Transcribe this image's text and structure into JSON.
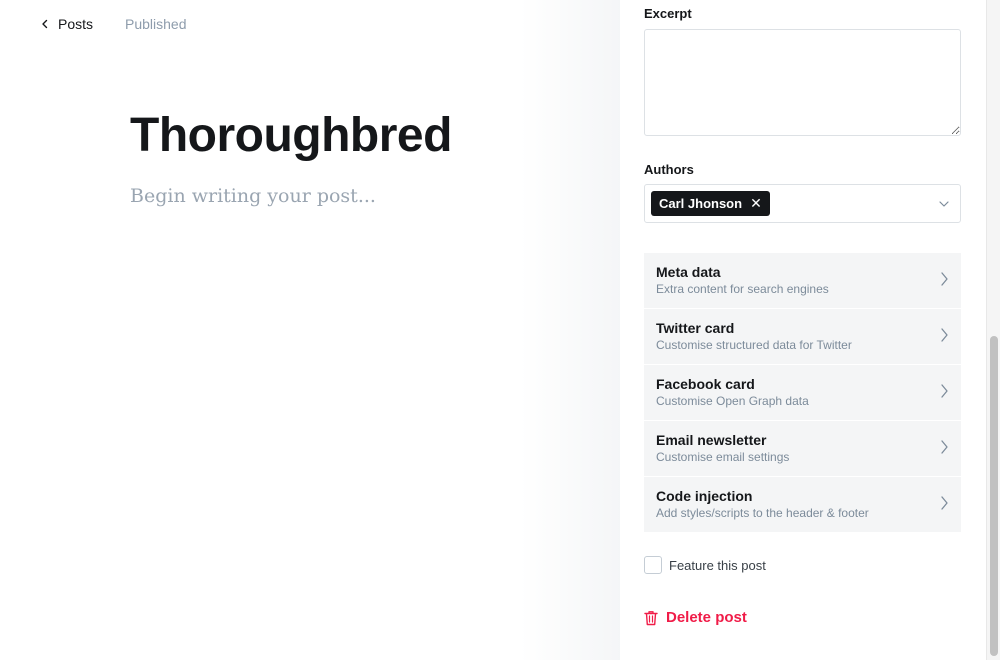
{
  "editor": {
    "back_label": "Posts",
    "status": "Published",
    "title": "Thoroughbred",
    "body_placeholder": "Begin writing your post..."
  },
  "settings": {
    "excerpt_label": "Excerpt",
    "excerpt_value": "",
    "authors_label": "Authors",
    "authors": [
      "Carl Jhonson"
    ],
    "menu": [
      {
        "title": "Meta data",
        "desc": "Extra content for search engines"
      },
      {
        "title": "Twitter card",
        "desc": "Customise structured data for Twitter"
      },
      {
        "title": "Facebook card",
        "desc": "Customise Open Graph data"
      },
      {
        "title": "Email newsletter",
        "desc": "Customise email settings"
      },
      {
        "title": "Code injection",
        "desc": "Add styles/scripts to the header & footer"
      }
    ],
    "feature_label": "Feature this post",
    "feature_checked": false,
    "delete_label": "Delete post"
  },
  "colors": {
    "danger": "#f01c48",
    "token_bg": "#15171a",
    "menu_bg": "#f4f5f6",
    "muted_text": "#7c8b9a"
  },
  "icons": [
    "chevron-left-icon",
    "close-icon",
    "chevron-down-icon",
    "chevron-right-icon",
    "trash-icon"
  ]
}
